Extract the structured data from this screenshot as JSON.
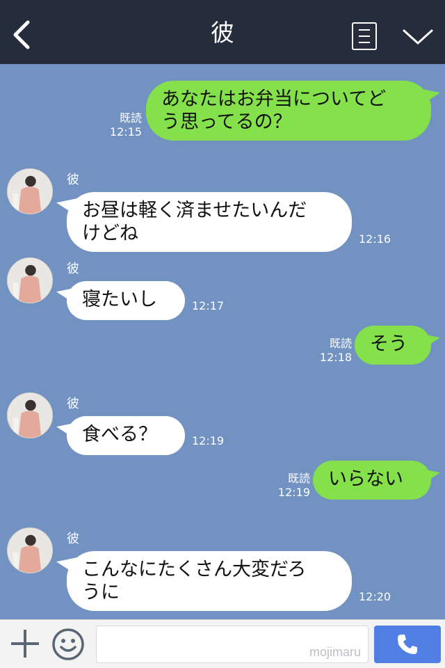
{
  "header": {
    "title": "彼"
  },
  "messages": [
    {
      "side": "me",
      "text_lines": [
        "あなたはお弁当についてど",
        "う思ってるの？"
      ],
      "read": "既読",
      "time": "12:15"
    },
    {
      "side": "them",
      "sender": "彼",
      "text_lines": [
        "お昼は軽く済ませたいんだ",
        "けどね"
      ],
      "time": "12:16"
    },
    {
      "side": "them",
      "sender": "彼",
      "text_lines": [
        "寝たいし"
      ],
      "time": "12:17"
    },
    {
      "side": "me",
      "text_lines": [
        "そう"
      ],
      "read": "既読",
      "time": "12:18"
    },
    {
      "side": "them",
      "sender": "彼",
      "text_lines": [
        "食べる？"
      ],
      "time": "12:19"
    },
    {
      "side": "me",
      "text_lines": [
        "いらない"
      ],
      "read": "既読",
      "time": "12:19"
    },
    {
      "side": "them",
      "sender": "彼",
      "text_lines": [
        "こんなにたくさん大変だろ",
        "うに"
      ],
      "time": "12:20"
    }
  ],
  "footer": {
    "watermark": "mojimaru"
  },
  "colors": {
    "background": "#7292c2",
    "header": "#252c3c",
    "my_bubble": "#84e14b",
    "their_bubble": "#ffffff",
    "call_button": "#4f7fe3"
  },
  "icons": [
    "back-arrow-icon",
    "menu-list-icon",
    "chevron-down-icon",
    "plus-icon",
    "emoji-icon",
    "phone-icon"
  ]
}
